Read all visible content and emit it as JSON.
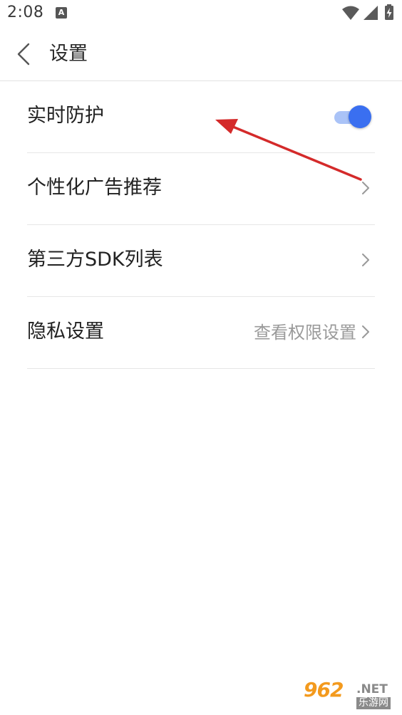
{
  "status_bar": {
    "time": "2:08",
    "notification_glyph": "A",
    "icons": [
      "wifi-icon",
      "signal-icon",
      "battery-charging-icon"
    ]
  },
  "header": {
    "title": "设置",
    "back_icon": "chevron-left-icon"
  },
  "settings": {
    "items": [
      {
        "label": "实时防护",
        "control": "toggle",
        "toggle_on": true
      },
      {
        "label": "个性化广告推荐",
        "control": "chevron"
      },
      {
        "label": "第三方SDK列表",
        "control": "chevron"
      },
      {
        "label": "隐私设置",
        "value": "查看权限设置",
        "control": "chevron"
      }
    ]
  },
  "watermark": {
    "main": "962",
    "net": ".NET",
    "sub": "乐游网"
  },
  "colors": {
    "accent": "#3a6ff0",
    "toggle_track": "#aac3f7",
    "divider": "#e6e6e6",
    "annotation_arrow": "#d42a2a",
    "secondary_text": "#9a9a9a"
  }
}
